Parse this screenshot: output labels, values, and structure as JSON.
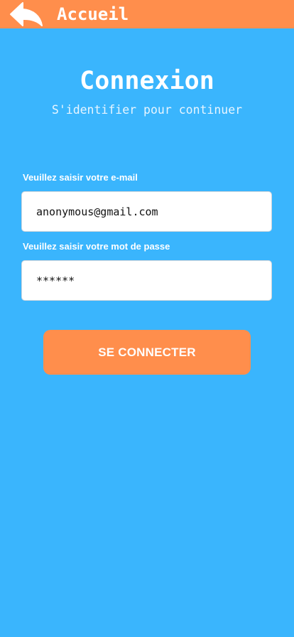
{
  "header": {
    "back_icon": "reply-arrow-icon",
    "title": "Accueil"
  },
  "login": {
    "title": "Connexion",
    "subtitle": "S'identifier pour continuer",
    "email": {
      "label": "Veuillez saisir votre e-mail",
      "value": "anonymous@gmail.com"
    },
    "password": {
      "label": "Veuillez saisir votre mot de passe",
      "value": "******"
    },
    "submit_label": "SE CONNECTER"
  },
  "colors": {
    "background": "#3ab5fd",
    "accent": "#ff8e4c",
    "text_on_color": "#ffffff"
  }
}
